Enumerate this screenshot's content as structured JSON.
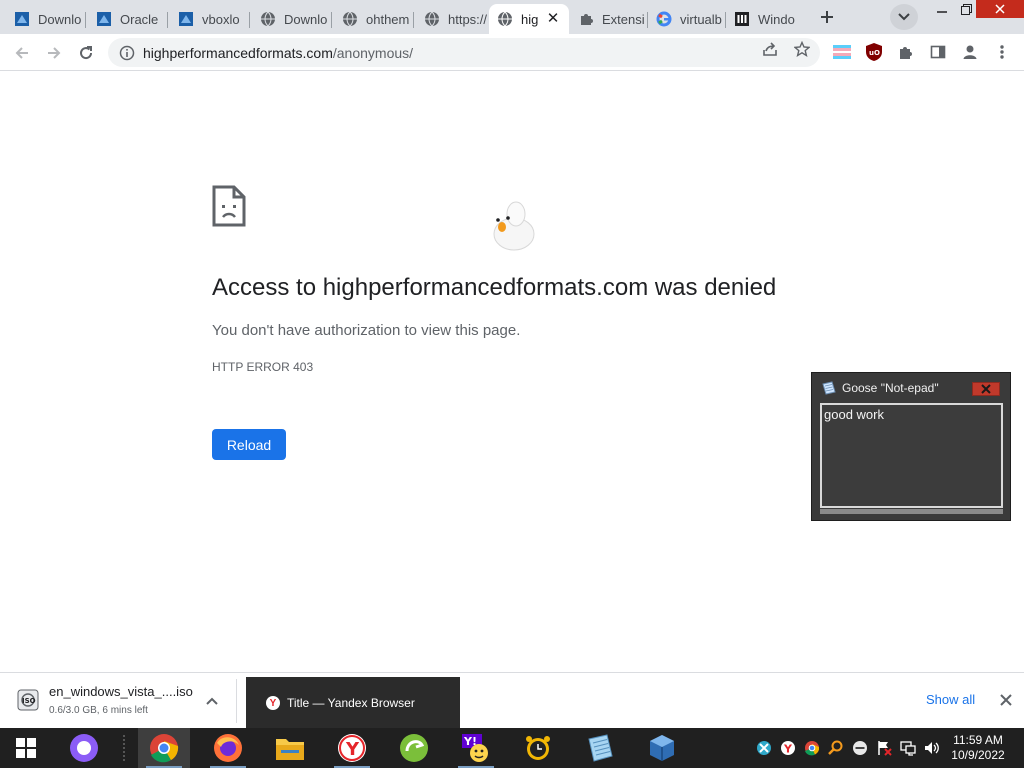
{
  "browser": {
    "tabs": [
      {
        "title": "Downlo",
        "icon": "virtualbox-icon"
      },
      {
        "title": "Oracle",
        "icon": "virtualbox-icon"
      },
      {
        "title": "vboxlo",
        "icon": "virtualbox-icon"
      },
      {
        "title": "Downlo",
        "icon": "globe-icon"
      },
      {
        "title": "ohthem",
        "icon": "globe-icon"
      },
      {
        "title": "https://",
        "icon": "globe-icon"
      },
      {
        "title": "hig",
        "icon": "globe-icon",
        "active": true
      },
      {
        "title": "Extensi",
        "icon": "puzzle-icon"
      },
      {
        "title": "virtualb",
        "icon": "google-icon"
      },
      {
        "title": "Windo",
        "icon": "museum-icon"
      }
    ],
    "url_domain": "highperformancedformats.com",
    "url_path": "/anonymous/"
  },
  "error_page": {
    "title": "Access to highperformancedformats.com was denied",
    "message": "You don't have authorization to view this page.",
    "code": "HTTP ERROR 403",
    "reload_label": "Reload"
  },
  "notepad": {
    "title": "Goose \"Not-epad\"",
    "text": "good work"
  },
  "download": {
    "filename": "en_windows_vista_....iso",
    "status": "0.6/3.0 GB, 6 mins left",
    "show_all": "Show all"
  },
  "tooltip": {
    "text": "Title — Yandex Browser"
  },
  "taskbar": {
    "time": "11:59 AM",
    "date": "10/9/2022",
    "apps": [
      "start",
      "alice",
      "chrome",
      "firefox",
      "file-explorer",
      "yandex",
      "greenshot",
      "yahoo",
      "alarm",
      "notepad",
      "virtualbox"
    ]
  },
  "colors": {
    "accent": "#1a73e8",
    "tabstrip": "#dee1e6",
    "taskbar": "#202020"
  }
}
